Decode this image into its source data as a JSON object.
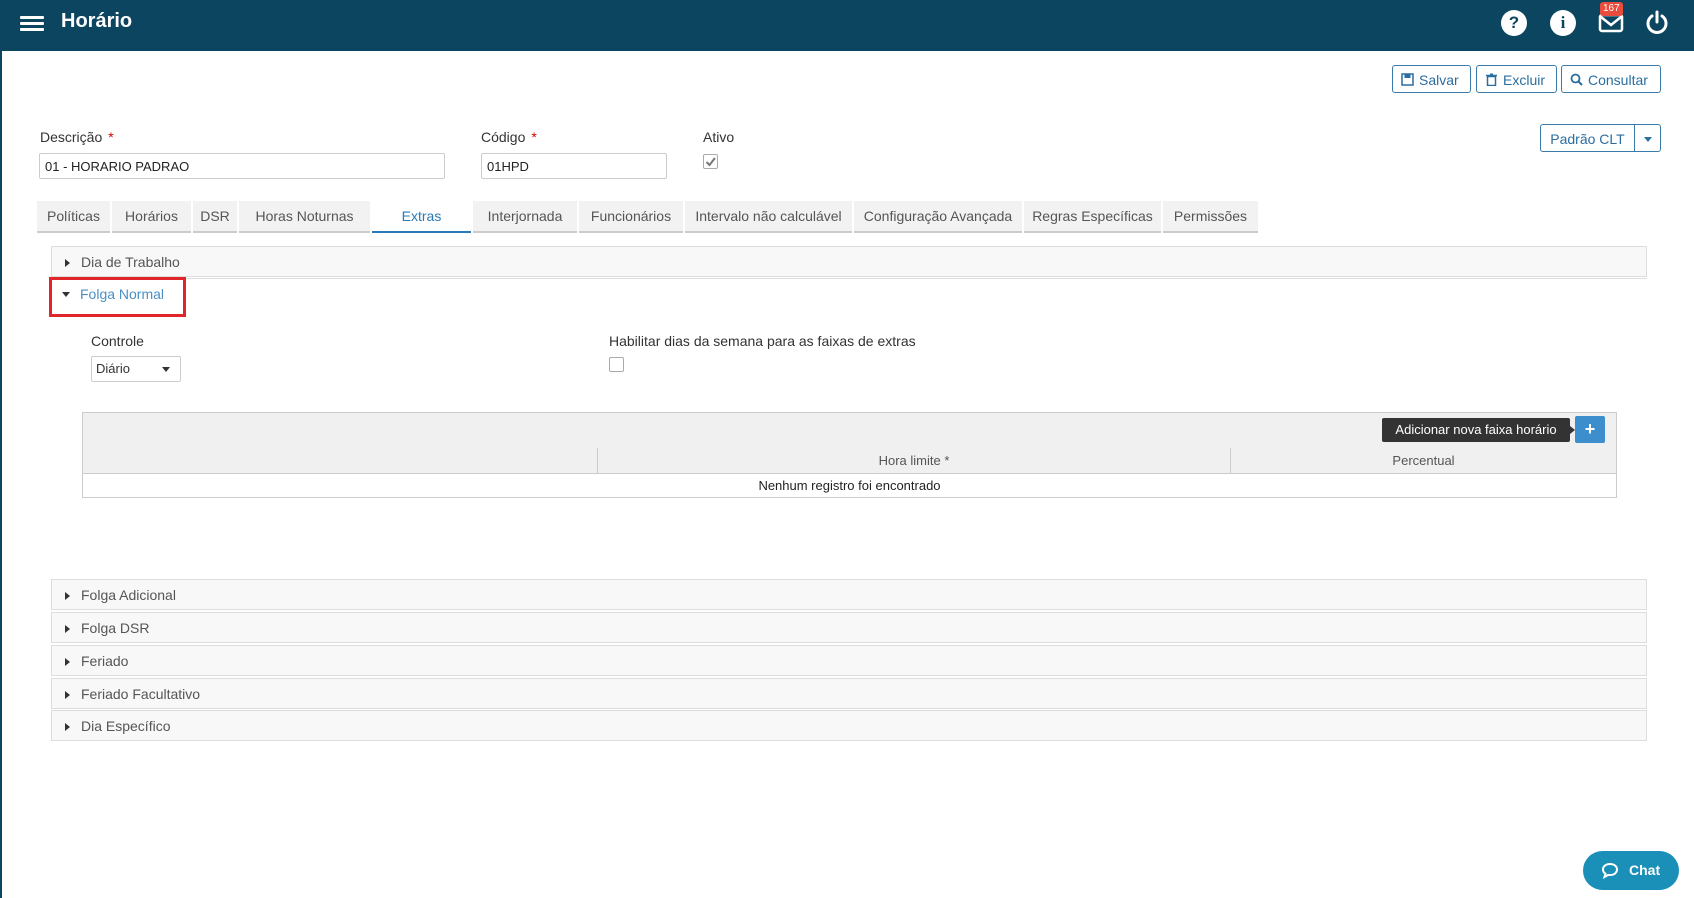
{
  "header": {
    "title": "Horário",
    "help_icon": "question-icon",
    "info_icon": "info-icon",
    "mail_icon": "mail-icon",
    "mail_badge": "167",
    "power_icon": "power-icon"
  },
  "toolbar": {
    "save_label": "Salvar",
    "delete_label": "Excluir",
    "search_label": "Consultar"
  },
  "form": {
    "descricao_label": "Descrição",
    "descricao_value": "01 - HORARIO PADRAO",
    "codigo_label": "Código",
    "codigo_value": "01HPD",
    "ativo_label": "Ativo",
    "ativo_checked": true,
    "required_mark": "*",
    "padrao_label": "Padrão CLT"
  },
  "tabs": [
    {
      "label": "Políticas"
    },
    {
      "label": "Horários"
    },
    {
      "label": "DSR"
    },
    {
      "label": "Horas Noturnas"
    },
    {
      "label": "Extras",
      "active": true
    },
    {
      "label": "Interjornada"
    },
    {
      "label": "Funcionários"
    },
    {
      "label": "Intervalo não calculável"
    },
    {
      "label": "Configuração Avançada"
    },
    {
      "label": "Regras Específicas"
    },
    {
      "label": "Permissões"
    }
  ],
  "sections": {
    "dia_trabalho": "Dia de Trabalho",
    "folga_normal": "Folga Normal",
    "folga_adicional": "Folga Adicional",
    "folga_dsr": "Folga DSR",
    "feriado": "Feriado",
    "feriado_facultativo": "Feriado Facultativo",
    "dia_especifico": "Dia Específico"
  },
  "folga_normal": {
    "controle_label": "Controle",
    "controle_value": "Diário",
    "habilitar_label": "Habilitar dias da semana para as faixas de extras",
    "habilitar_checked": false,
    "grid": {
      "columns": [
        "",
        "Hora limite *",
        "Percentual"
      ],
      "empty_message": "Nenhum registro foi encontrado",
      "add_tooltip": "Adicionar nova faixa horário",
      "add_label": "+"
    }
  },
  "chat": {
    "label": "Chat"
  },
  "colors": {
    "header_bg": "#0b4560",
    "accent": "#2a7ab8",
    "highlight_box": "#e0262b",
    "chat_bg": "#1a8fb8"
  }
}
